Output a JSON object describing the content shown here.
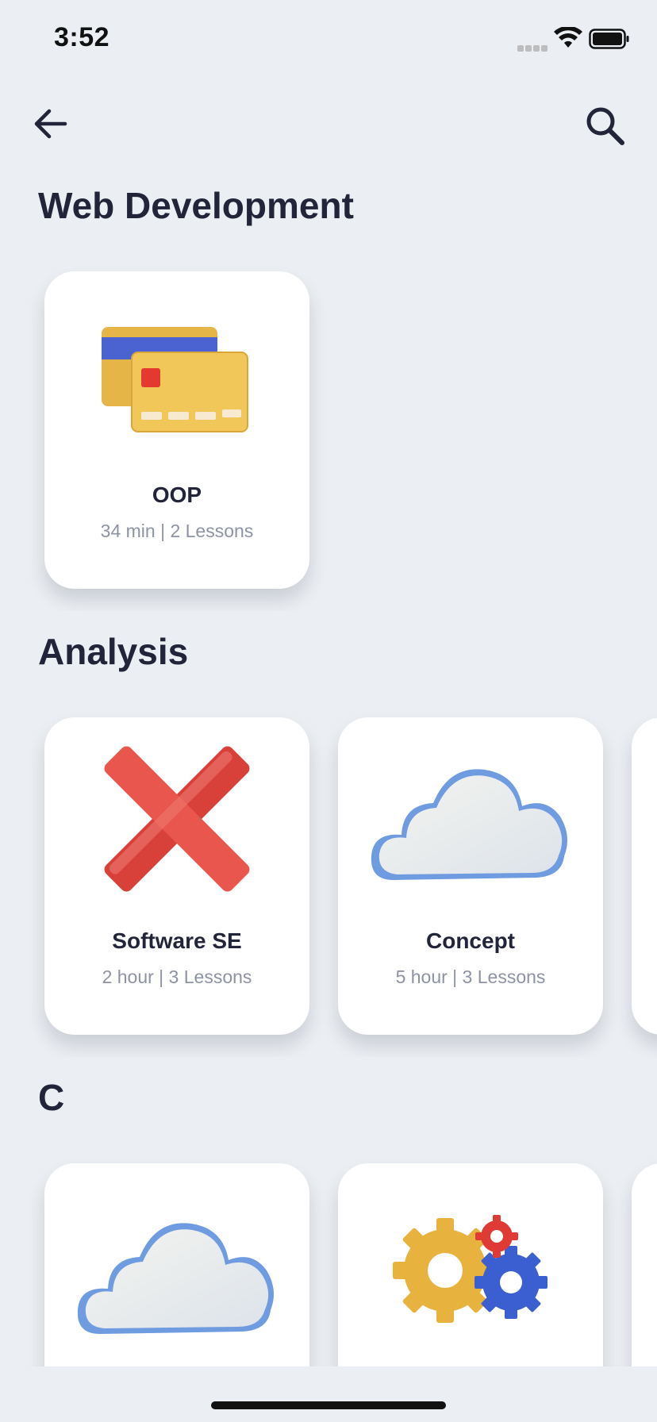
{
  "status_bar": {
    "time": "3:52"
  },
  "nav": {
    "back_icon": "arrow-left-icon",
    "search_icon": "search-icon"
  },
  "sections": [
    {
      "title": "Web Development",
      "courses": [
        {
          "title": "OOP",
          "meta": "34 min | 2 Lessons",
          "icon": "credit-cards-icon"
        }
      ]
    },
    {
      "title": "Analysis",
      "courses": [
        {
          "title": "Software SE",
          "meta": "2 hour | 3 Lessons",
          "icon": "red-x-icon"
        },
        {
          "title": "Concept",
          "meta": "5 hour | 3 Lessons",
          "icon": "cloud-icon"
        }
      ]
    },
    {
      "title": "C",
      "courses": [
        {
          "icon": "cloud-icon"
        },
        {
          "icon": "gears-icon"
        }
      ]
    }
  ],
  "colors": {
    "background": "#ebeef2",
    "title": "#22243a",
    "meta": "#8d93a3",
    "card": "#ffffff"
  }
}
